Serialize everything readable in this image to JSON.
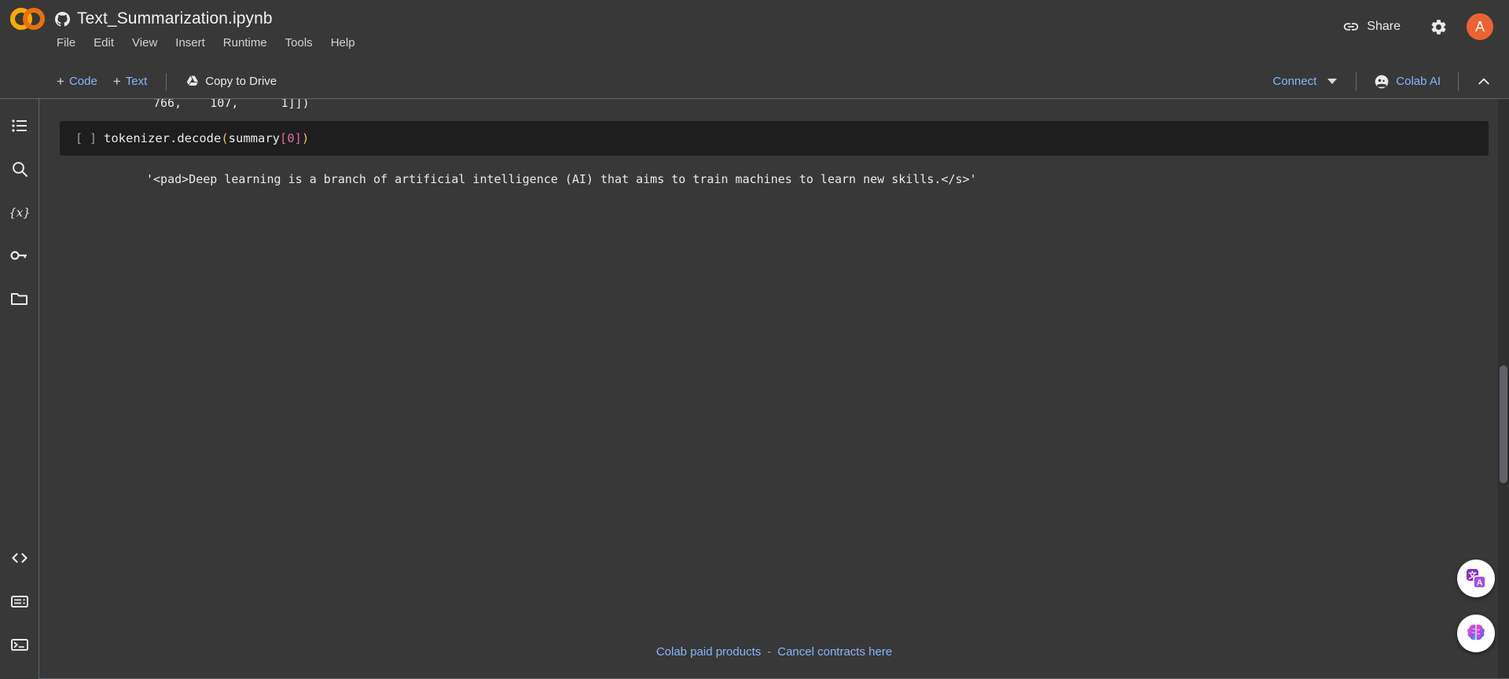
{
  "app": {
    "logo_icon": "colab-logo",
    "logo_colors": [
      "#F9AB00",
      "#E8710A"
    ]
  },
  "titlebar": {
    "source_icon": "github-icon",
    "filename": "Text_Summarization.ipynb",
    "menu": [
      {
        "label": "File"
      },
      {
        "label": "Edit"
      },
      {
        "label": "View"
      },
      {
        "label": "Insert"
      },
      {
        "label": "Runtime"
      },
      {
        "label": "Tools"
      },
      {
        "label": "Help"
      }
    ],
    "share_label": "Share",
    "share_icon": "link-icon",
    "settings_icon": "gear-icon",
    "avatar_initial": "A",
    "avatar_color": "#ec6333"
  },
  "toolbar": {
    "add_code_label": "Code",
    "add_text_label": "Text",
    "plus_glyph": "+",
    "copy_to_drive_label": "Copy to Drive",
    "copy_to_drive_icon": "drive-icon",
    "connect_label": "Connect",
    "connect_caret_icon": "chevron-down-icon",
    "colab_ai_label": "Colab AI",
    "colab_ai_icon": "colab-ai-face-icon",
    "collapse_icon": "chevron-up-icon"
  },
  "sidebar": {
    "items": [
      {
        "name": "table-of-contents",
        "icon": "list-icon"
      },
      {
        "name": "find-and-replace",
        "icon": "search-icon"
      },
      {
        "name": "variables",
        "icon": "variables-icon"
      },
      {
        "name": "secrets",
        "icon": "key-icon"
      },
      {
        "name": "files",
        "icon": "folder-icon"
      }
    ],
    "bottom_items": [
      {
        "name": "code-snippets",
        "icon": "code-brackets-icon"
      },
      {
        "name": "command-palette",
        "icon": "command-palette-icon"
      },
      {
        "name": "terminal",
        "icon": "terminal-icon"
      }
    ]
  },
  "notebook": {
    "clipped_output_above": "766,    107,      1]])",
    "cell": {
      "prompt": "[ ]",
      "code_parts": [
        {
          "text": "tokenizer.decode",
          "type": "plain"
        },
        {
          "text": "(",
          "type": "paren"
        },
        {
          "text": "summary",
          "type": "plain"
        },
        {
          "text": "[",
          "type": "bracket"
        },
        {
          "text": "0",
          "type": "num"
        },
        {
          "text": "]",
          "type": "bracket"
        },
        {
          "text": ")",
          "type": "paren"
        }
      ],
      "code_text": "tokenizer.decode(summary[0])",
      "output": "'<pad>Deep learning is a branch of artificial intelligence (AI) that aims to train machines to learn new skills.</s>'"
    }
  },
  "footer": {
    "paid_products_label": "Colab paid products",
    "separator": "-",
    "cancel_contracts_label": "Cancel contracts here"
  },
  "fabs": [
    {
      "name": "translate-fab",
      "icon": "translate-icon"
    },
    {
      "name": "gemini-fab",
      "icon": "gemini-brain-icon"
    }
  ]
}
